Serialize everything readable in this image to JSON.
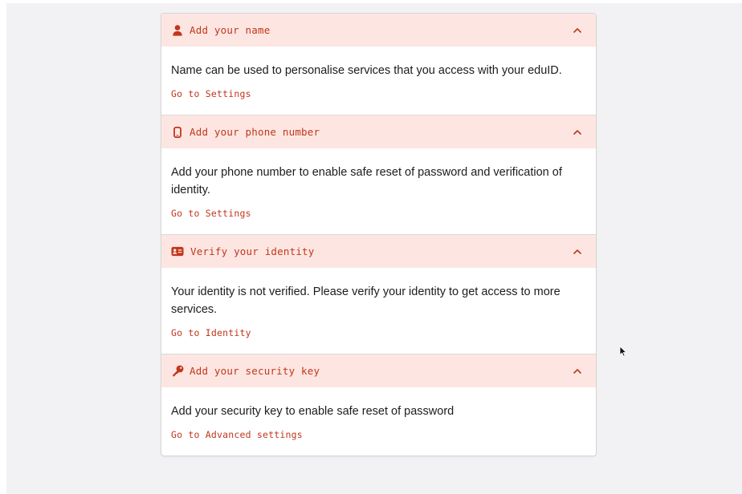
{
  "colors": {
    "accent": "#c1361d",
    "header_bg": "#fde6e1",
    "page_bg": "#f2f2f4",
    "text": "#1c1c1c"
  },
  "sections": [
    {
      "icon": "user-icon",
      "title": "Add your name",
      "text": "Name can be used to personalise services that you access with your eduID.",
      "link": "Go to Settings"
    },
    {
      "icon": "phone-icon",
      "title": "Add your phone number",
      "text": "Add your phone number to enable safe reset of password and verification of identity.",
      "link": "Go to Settings"
    },
    {
      "icon": "id-card-icon",
      "title": "Verify your identity",
      "text": "Your identity is not verified. Please verify your identity to get access to more services.",
      "link": "Go to Identity"
    },
    {
      "icon": "key-icon",
      "title": "Add your security key",
      "text": "Add your security key to enable safe reset of password",
      "link": "Go to Advanced settings"
    }
  ]
}
